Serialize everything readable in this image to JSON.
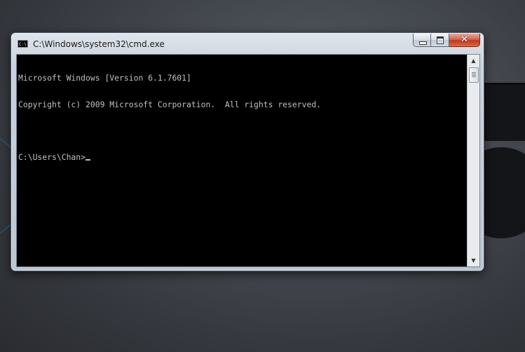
{
  "window": {
    "title": "C:\\Windows\\system32\\cmd.exe",
    "icon_text": "C:\\",
    "controls": {
      "minimize": "minimize",
      "maximize": "maximize",
      "close": "✕"
    }
  },
  "console": {
    "lines": [
      "Microsoft Windows [Version 6.1.7601]",
      "Copyright (c) 2009 Microsoft Corporation.  All rights reserved.",
      "",
      "C:\\Users\\Chan>"
    ]
  },
  "scrollbar": {
    "up_arrow": "▲",
    "down_arrow": "▼"
  },
  "colors": {
    "console_bg": "#000000",
    "console_text": "#c0c0c0",
    "close_button": "#c2381b"
  },
  "icons": [
    "cmd-app-icon",
    "minimize-icon",
    "maximize-icon",
    "close-icon",
    "scroll-up-icon",
    "scroll-down-icon"
  ]
}
